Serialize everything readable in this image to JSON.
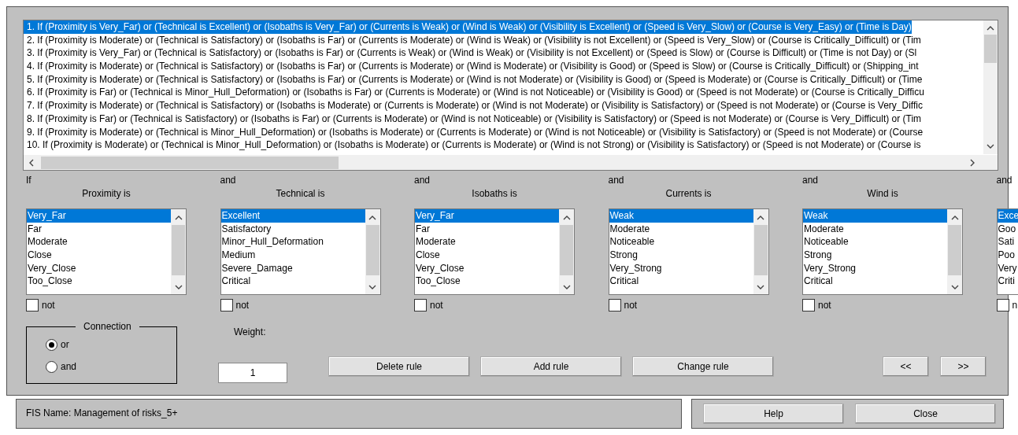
{
  "rules": {
    "items": [
      {
        "text": "1. If (Proximity is Very_Far) or (Technical is Excellent) or (Isobaths is Very_Far) or (Currents is Weak) or (Wind is Weak) or (Visibility is Excellent) or (Speed is Very_Slow) or (Course is Very_Easy) or (Time is Day)",
        "selected": true
      },
      {
        "text": "2. If (Proximity is Moderate) or (Technical is Satisfactory) or (Isobaths is Far) or (Currents is Moderate) or (Wind is Weak) or (Visibility is not Excellent) or (Speed is Very_Slow) or (Course is Critically_Difficult) or (Tim",
        "selected": false
      },
      {
        "text": "3. If (Proximity is Very_Far) or (Technical is Satisfactory) or (Isobaths is Far) or (Currents is Weak) or (Wind is Weak) or (Visibility is not Excellent) or (Speed is Slow) or (Course is Difficult) or (Time is not Day) or (Sl",
        "selected": false
      },
      {
        "text": "4. If (Proximity is Moderate) or (Technical is Satisfactory) or (Isobaths is Far) or (Currents is Moderate) or (Wind is Moderate) or (Visibility is Good) or (Speed is Slow) or (Course is Critically_Difficult) or (Shipping_int",
        "selected": false
      },
      {
        "text": "5. If (Proximity is Moderate) or (Technical is Satisfactory) or (Isobaths is Far) or (Currents is Moderate) or (Wind is not Moderate) or (Visibility is Good) or (Speed is Moderate) or (Course is Critically_Difficult) or (Time",
        "selected": false
      },
      {
        "text": "6. If (Proximity is Far) or (Technical is Minor_Hull_Deformation) or (Isobaths is Far) or (Currents is Moderate) or (Wind is not Noticeable) or (Visibility is Good) or (Speed is not Moderate) or (Course is Critically_Difficu",
        "selected": false
      },
      {
        "text": "7. If (Proximity is Moderate) or (Technical is Satisfactory) or (Isobaths is Moderate) or (Currents is Moderate) or (Wind is not Moderate) or (Visibility is Satisfactory) or (Speed is not Moderate) or (Course is Very_Diffic",
        "selected": false
      },
      {
        "text": "8. If (Proximity is Far) or (Technical is Satisfactory) or (Isobaths is Far) or (Currents is Moderate) or (Wind is not Noticeable) or (Visibility is Satisfactory) or (Speed is not Moderate) or (Course is Very_Difficult) or (Tim",
        "selected": false
      },
      {
        "text": "9. If (Proximity is Moderate) or (Technical is Minor_Hull_Deformation) or (Isobaths is Moderate) or (Currents is Moderate) or (Wind is not Noticeable) or (Visibility is Satisfactory) or (Speed is not Moderate) or (Course",
        "selected": false
      },
      {
        "text": "10. If (Proximity is Moderate) or (Technical is Minor_Hull_Deformation) or (Isobaths is Moderate) or (Currents is Moderate) or (Wind is not Strong) or (Visibility is Satisfactory) or (Speed is not Moderate) or (Course is",
        "selected": false
      }
    ]
  },
  "antecedents": [
    {
      "kind": "full",
      "connector": "If",
      "label": "Proximity is",
      "items": [
        {
          "text": "Very_Far",
          "selected": true
        },
        {
          "text": "Far",
          "selected": false
        },
        {
          "text": "Moderate",
          "selected": false
        },
        {
          "text": "Close",
          "selected": false
        },
        {
          "text": "Very_Close",
          "selected": false
        },
        {
          "text": "Too_Close",
          "selected": false
        }
      ],
      "not": {
        "label": "not",
        "checked": false
      }
    },
    {
      "kind": "full",
      "connector": "and",
      "label": "Technical is",
      "items": [
        {
          "text": "Excellent",
          "selected": true
        },
        {
          "text": "Satisfactory",
          "selected": false
        },
        {
          "text": "Minor_Hull_Deformation",
          "selected": false
        },
        {
          "text": "Medium",
          "selected": false
        },
        {
          "text": "Severe_Damage",
          "selected": false
        },
        {
          "text": "Critical",
          "selected": false
        }
      ],
      "not": {
        "label": "not",
        "checked": false
      }
    },
    {
      "kind": "full",
      "connector": "and",
      "label": "Isobaths is",
      "items": [
        {
          "text": "Very_Far",
          "selected": true
        },
        {
          "text": "Far",
          "selected": false
        },
        {
          "text": "Moderate",
          "selected": false
        },
        {
          "text": "Close",
          "selected": false
        },
        {
          "text": "Very_Close",
          "selected": false
        },
        {
          "text": "Too_Close",
          "selected": false
        }
      ],
      "not": {
        "label": "not",
        "checked": false
      }
    },
    {
      "kind": "full",
      "connector": "and",
      "label": "Currents is",
      "items": [
        {
          "text": "Weak",
          "selected": true
        },
        {
          "text": "Moderate",
          "selected": false
        },
        {
          "text": "Noticeable",
          "selected": false
        },
        {
          "text": "Strong",
          "selected": false
        },
        {
          "text": "Very_Strong",
          "selected": false
        },
        {
          "text": "Critical",
          "selected": false
        }
      ],
      "not": {
        "label": "not",
        "checked": false
      }
    },
    {
      "kind": "full",
      "connector": "and",
      "label": "Wind is",
      "items": [
        {
          "text": "Weak",
          "selected": true
        },
        {
          "text": "Moderate",
          "selected": false
        },
        {
          "text": "Noticeable",
          "selected": false
        },
        {
          "text": "Strong",
          "selected": false
        },
        {
          "text": "Very_Strong",
          "selected": false
        },
        {
          "text": "Critical",
          "selected": false
        }
      ],
      "not": {
        "label": "not",
        "checked": false
      }
    },
    {
      "kind": "partial",
      "connector": "and",
      "items": [
        {
          "text": "Exce",
          "selected": true
        },
        {
          "text": "Goo",
          "selected": false
        },
        {
          "text": "Sati",
          "selected": false
        },
        {
          "text": "Poo",
          "selected": false
        },
        {
          "text": "Very",
          "selected": false
        },
        {
          "text": "Criti",
          "selected": false
        }
      ],
      "not": {
        "label": "n",
        "checked": false
      }
    }
  ],
  "connection": {
    "title": "Connection",
    "options": [
      {
        "label": "or",
        "selected": true
      },
      {
        "label": "and",
        "selected": false
      }
    ]
  },
  "weight": {
    "label": "Weight:",
    "value": "1"
  },
  "actions": [
    "Delete rule",
    "Add rule",
    "Change rule"
  ],
  "navigation": [
    "<<",
    ">>"
  ],
  "status": "FIS Name: Management of risks_5+",
  "footer_buttons": [
    "Help",
    "Close"
  ]
}
